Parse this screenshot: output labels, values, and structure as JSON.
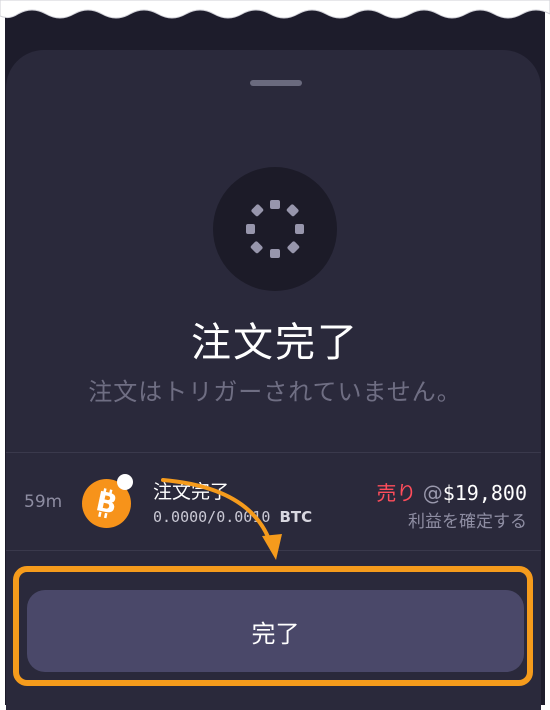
{
  "modal": {
    "title": "注文完了",
    "subtitle": "注文はトリガーされていません。"
  },
  "order": {
    "age": "59m",
    "asset_icon": "bitcoin-icon",
    "name": "注文完了",
    "quantity": "0.0000/0.0010",
    "unit": "BTC",
    "side": "売り",
    "at": "@",
    "price": "$19,800",
    "type": "利益を確定する"
  },
  "actions": {
    "done_label": "完了"
  },
  "colors": {
    "accent_highlight": "#f59b1c",
    "sell": "#ff4d5b",
    "bitcoin": "#f7931a",
    "button": "#4a4869"
  }
}
